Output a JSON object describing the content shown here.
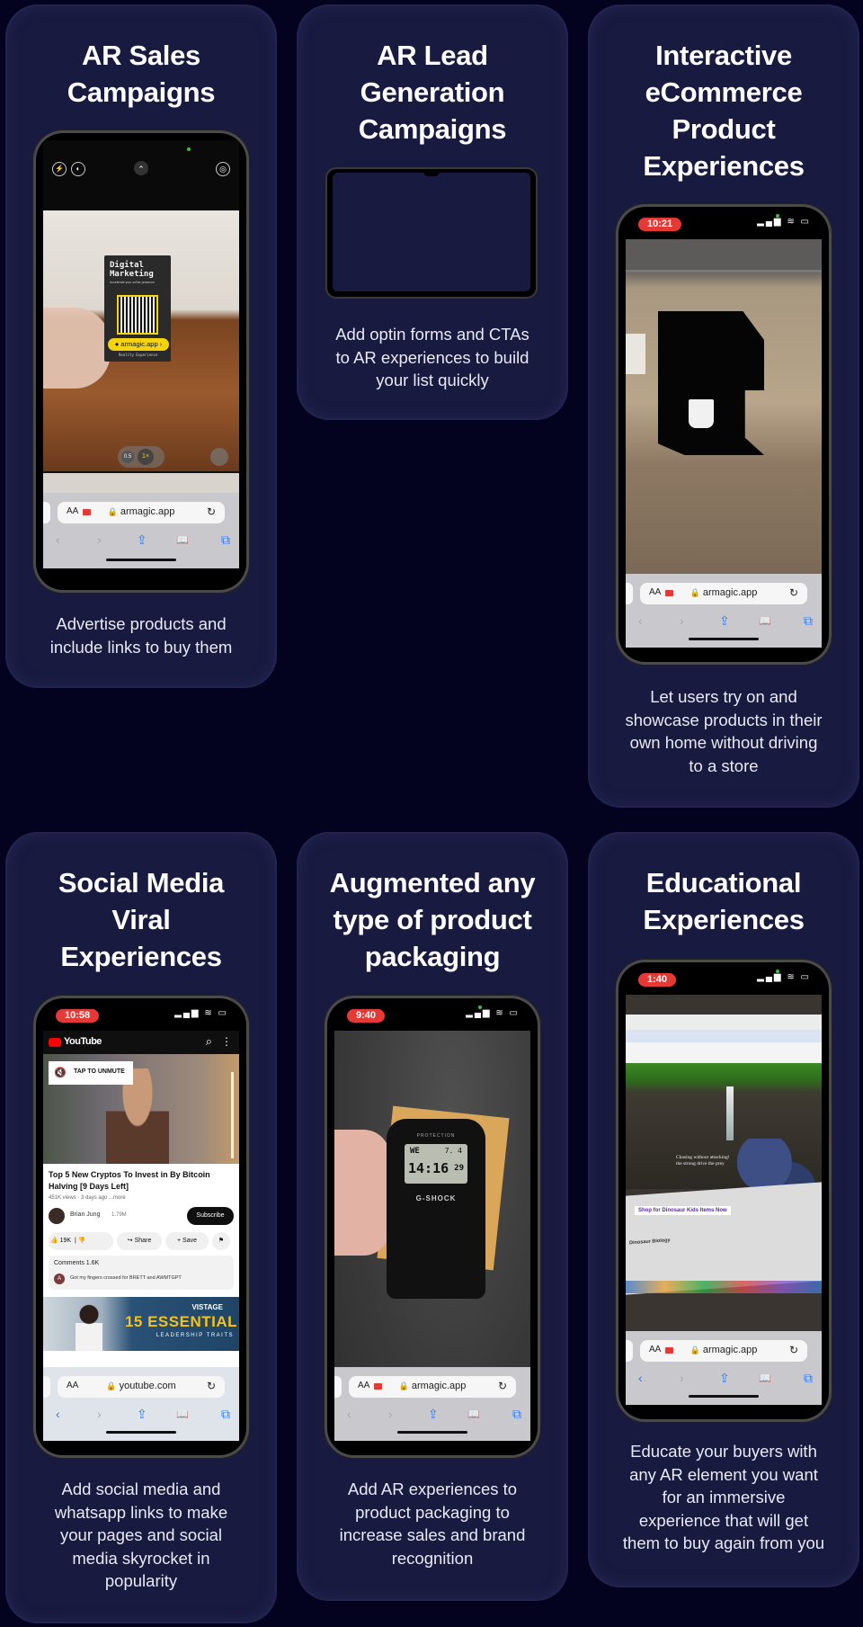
{
  "colors": {
    "page_background": "#03021f",
    "card_background": "#181a40",
    "recording_pill": "#e53935",
    "safari_link_blue": "#2f7cf6",
    "youtube_red": "#ff0000"
  },
  "cards": [
    {
      "title": "AR Sales\nCampaigns",
      "description": "Advertise products and\ninclude links to buy them",
      "phone": {
        "type": "camera",
        "camera_controls": {
          "flash_icon": "⚡",
          "live_icon": "◐",
          "chevron_icon": "⌃",
          "settings_icon": "◎"
        },
        "business_card": {
          "headline": "Digital\nMarketing",
          "subline": "Accelerate your online presence",
          "cta": "armagic.app",
          "footer": "Reality Experience"
        },
        "zoom_options": [
          "0.5",
          "1×"
        ],
        "url": "armagic.app",
        "aa_label": "AA",
        "reload_icon": "↻",
        "nav_icons": {
          "back": "‹",
          "forward": "›",
          "share": "⇪",
          "bookmarks": "📖",
          "tabs": "⧉"
        }
      }
    },
    {
      "title": "AR Lead\nGeneration\nCampaigns",
      "description": "Add optin forms and CTAs\nto AR experiences to build\nyour list quickly",
      "phone": {
        "type": "blank"
      }
    },
    {
      "title": "Interactive\neCommerce\nProduct\nExperiences",
      "description": "Let users try on and\nshowcase products in their\nown home without driving\nto a store",
      "phone": {
        "type": "ar-product",
        "time": "10:21",
        "status_icons": "▂▄▆ ≋ ▭",
        "url": "armagic.app",
        "aa_label": "AA",
        "reload_icon": "↻",
        "nav_icons": {
          "back": "‹",
          "forward": "›",
          "share": "⇪",
          "bookmarks": "📖",
          "tabs": "⧉"
        }
      }
    },
    {
      "title": "Social Media\nViral\nExperiences",
      "description": "Add social media and\nwhatsapp links to make\nyour pages and social\nmedia skyrocket in\npopularity",
      "phone": {
        "type": "youtube",
        "time": "10:58",
        "status_icons": "▂▄▆ ≋ ▭",
        "youtube_logo": "YouTube",
        "search_icon": "⌕",
        "more_icon": "⋮",
        "unmute_label": "TAP TO UNMUTE",
        "video_title": "Top 5 New Cryptos To Invest in By Bitcoin Halving [9 Days Left]",
        "video_meta": "451K views · 3 days ago  ...more",
        "channel_name": "Brian Jung",
        "subscriber_count": "1.79M",
        "subscribe_label": "Subscribe",
        "likes": "19K",
        "share_label": "Share",
        "save_label": "Save",
        "comments_label": "Comments 1.6K",
        "comment_avatar": "A",
        "comment_text": "Got my fingers crossed for BRETT and AWMTGPT",
        "ad_brand": "VISTAGE",
        "ad_headline": "15 ESSENTIAL",
        "ad_subline": "LEADERSHIP TRAITS",
        "url": "youtube.com",
        "aa_label": "AA",
        "reload_icon": "↻",
        "nav_icons": {
          "back": "‹",
          "forward": "›",
          "share": "⇪",
          "bookmarks": "📖",
          "tabs": "⧉"
        }
      }
    },
    {
      "title": "Augmented any\ntype of product\npackaging",
      "description": "Add AR experiences to\nproduct packaging to\nincrease sales and brand\nrecognition",
      "phone": {
        "type": "ar-watch",
        "time": "9:40",
        "status_icons": "▂▄▆ ≋ ▭",
        "watch_brand": "G-SHOCK",
        "watch_label": "PROTECTION",
        "watch_day": "WE",
        "watch_date": "7. 4",
        "watch_time": "14:16",
        "watch_seconds": "29",
        "url": "armagic.app",
        "aa_label": "AA",
        "reload_icon": "↻",
        "nav_icons": {
          "back": "‹",
          "forward": "›",
          "share": "⇪",
          "bookmarks": "📖",
          "tabs": "⧉"
        }
      }
    },
    {
      "title": "Educational\nExperiences",
      "description": "Educate your buyers with\nany AR element you want\nfor an immersive\nexperience that will get\nthem to buy again from you",
      "phone": {
        "type": "ar-dinosaur",
        "time": "1:40",
        "status_icons": "▂▄▆ ≋ ▭",
        "ar_caption": "Chasing without attacking!\nthe strong drive the prey",
        "cta_label": "Shop for Dinosaur Kids Items Now",
        "article_heading": "Dinosaur Biology",
        "url": "armagic.app",
        "aa_label": "AA",
        "reload_icon": "↻",
        "nav_icons": {
          "back": "‹",
          "forward": "›",
          "share": "⇪",
          "bookmarks": "📖",
          "tabs": "⧉"
        }
      }
    }
  ]
}
